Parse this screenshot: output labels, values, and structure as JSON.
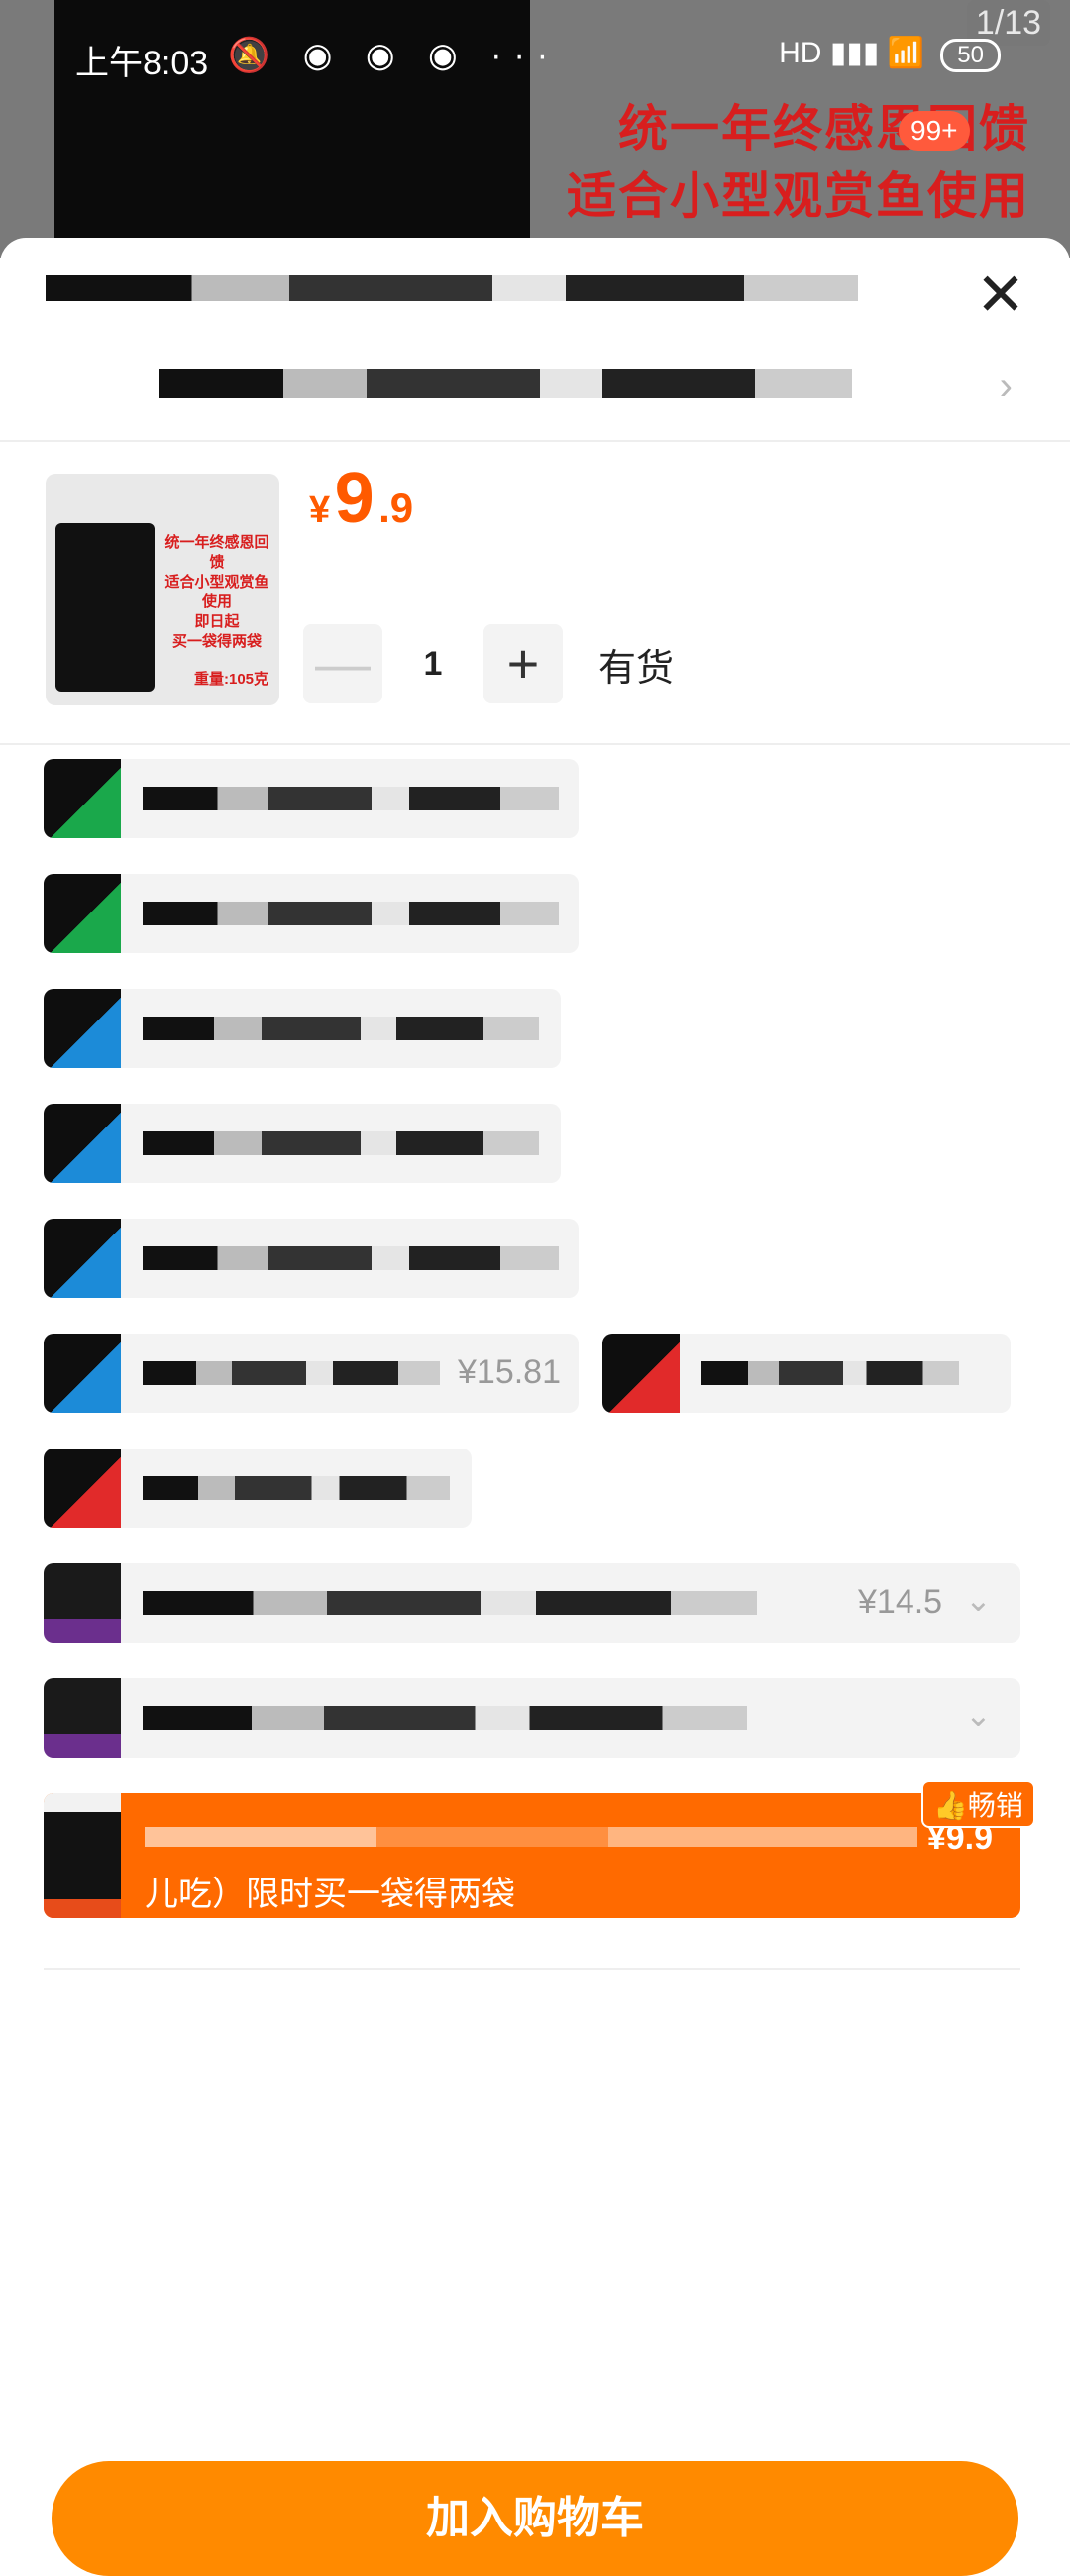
{
  "status_bar": {
    "time": "上午8:03",
    "notif_icons": "🔕 ◉ ◉ ◉ ···",
    "right_icons": "HD ▮▮▮ 📶",
    "battery": "50"
  },
  "background": {
    "page_index": "1/13",
    "promo_line1": "统一年终感恩回馈",
    "promo_line2": "适合小型观赏鱼使用",
    "badge": "99+"
  },
  "sheet": {
    "close_icon": "✕",
    "address_chevron": "›"
  },
  "product": {
    "thumb": {
      "lines": [
        "统一年终感恩回馈",
        "适合小型观赏鱼使用",
        "即日起",
        "买一袋得两袋"
      ],
      "weight": "重量:105克"
    },
    "price_currency": "¥",
    "price_int": "9",
    "price_dec": ".9",
    "qty_minus": "—",
    "qty_value": "1",
    "qty_plus": "+",
    "stock": "有货"
  },
  "options": [
    {
      "color": "green"
    },
    {
      "color": "green"
    },
    {
      "color": "blue"
    },
    {
      "color": "blue"
    },
    {
      "color": "blue"
    },
    {
      "color": "blue",
      "price": "¥15.81"
    },
    {
      "color": "red"
    },
    {
      "color": "red"
    },
    {
      "color": "black",
      "price": "¥14.5"
    },
    {
      "color": "black"
    }
  ],
  "selected_option": {
    "label": "儿吃）限时买一袋得两袋",
    "price": "¥9.9",
    "badge": "👍畅销"
  },
  "cart_button": "加入购物车",
  "colors": {
    "accent": "#ff6a00",
    "cart": "#ff8a00",
    "price": "#ff5a00"
  }
}
